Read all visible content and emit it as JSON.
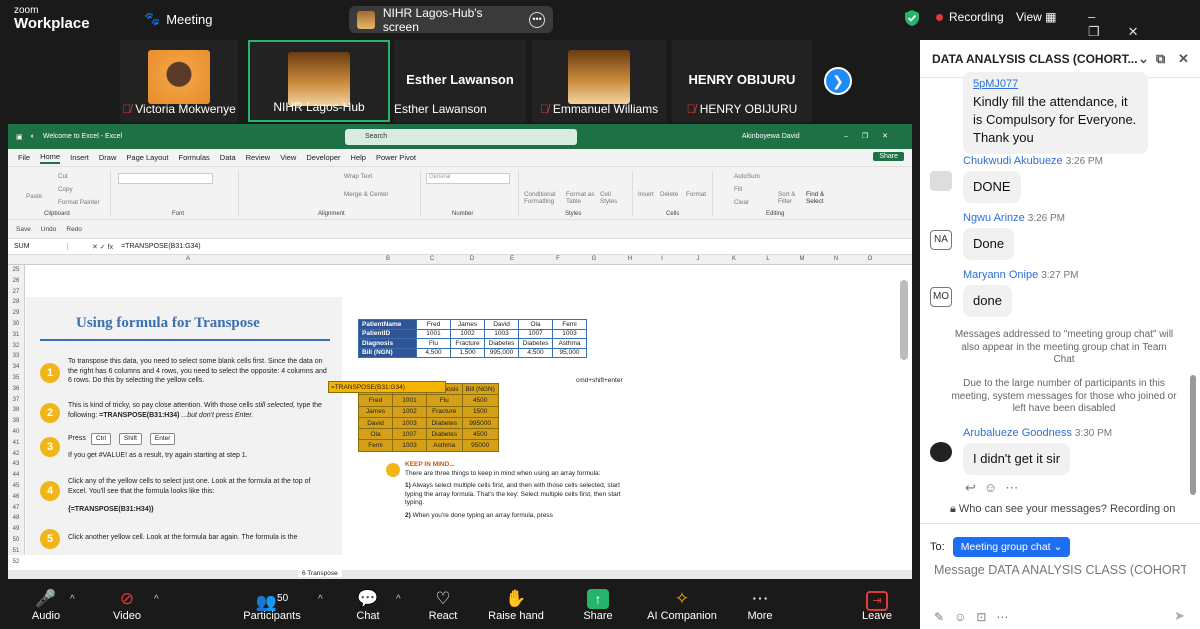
{
  "zoom": {
    "logo_line1": "zoom",
    "logo_line2": "Workplace",
    "meeting_label": "Meeting",
    "screen_share_title": "NIHR Lagos-Hub's screen",
    "recording_label": "Recording",
    "view_label": "View"
  },
  "participants": [
    {
      "name": "Victoria Mokwenye",
      "muted": true
    },
    {
      "name": "NIHR Lagos-Hub",
      "muted": false
    },
    {
      "name": "Esther  Lawanson",
      "big_name": "Esther  Lawanson",
      "muted": false
    },
    {
      "name": "Emmanuel Williams",
      "muted": true
    },
    {
      "name": "HENRY OBIJURU",
      "big_name": "HENRY OBIJURU",
      "muted": true
    }
  ],
  "excel": {
    "window_title": "Welcome to Excel  -  Excel",
    "search_placeholder": "Search",
    "user_name": "Akinboyewa David",
    "menu": [
      "File",
      "Home",
      "Insert",
      "Draw",
      "Page Layout",
      "Formulas",
      "Data",
      "Review",
      "View",
      "Developer",
      "Help",
      "Power Pivot"
    ],
    "active_menu": "Home",
    "share_label": "Share",
    "ribbon": {
      "cut": "Cut",
      "copy": "Copy",
      "paste": "Paste",
      "format_painter": "Format Painter",
      "clipboard": "Clipboard",
      "font": "Font",
      "alignment": "Alignment",
      "number": "Number",
      "styles": "Styles",
      "cells": "Cells",
      "editing": "Editing",
      "wrap_text": "Wrap Text",
      "merge_center": "Merge & Center",
      "general": "General",
      "conditional_formatting": "Conditional Formatting",
      "format_as_table": "Format as Table",
      "cell_styles": "Cell Styles",
      "insert": "Insert",
      "delete": "Delete",
      "format": "Format",
      "autosum": "AutoSum",
      "fill": "Fill",
      "clear": "Clear",
      "sort_filter": "Sort & Filter",
      "find_select": "Find & Select"
    },
    "quick_access": {
      "save": "Save",
      "undo": "Undo",
      "redo": "Redo"
    },
    "name_box": "SUM",
    "formula_bar": "=TRANSPOSE(B31:G34)",
    "columns": [
      "A",
      "B",
      "C",
      "D",
      "E",
      "F",
      "G",
      "H",
      "I",
      "J",
      "K",
      "L",
      "M",
      "N",
      "O"
    ],
    "rows": [
      "25",
      "26",
      "27",
      "28",
      "29",
      "30",
      "31",
      "32",
      "33",
      "34",
      "35",
      "36",
      "37",
      "38",
      "39",
      "40",
      "41",
      "42",
      "43",
      "44",
      "45",
      "46",
      "47",
      "48",
      "49",
      "50",
      "51",
      "52"
    ],
    "instructions": {
      "title": "Using formula for Transpose",
      "step1": "To transpose this data, you need to select some blank cells first. Since the data on the right has 6 columns and 4 rows, you need to select the opposite: 4 columns and 6 rows. Do this by selecting the yellow cells.",
      "step2_a": "This is kind of tricky, so pay close attention. With those cells ",
      "step2_b": "still selected,",
      "step2_c": " type the following: ",
      "step2_d": "=TRANSPOSE(B31:H34)",
      "step2_e": "  ...but don't press Enter.",
      "step3_press": "Press",
      "key_ctrl": "Ctrl",
      "key_shift": "Shift",
      "key_enter": "Enter",
      "step3_b": "If you get #VALUE! as a result, try again starting at step 1.",
      "step4": "Click any of the yellow cells to select just one. Look at the formula at the top of Excel. You'll see that the formula looks like this:",
      "step4_formula": "{=TRANSPOSE(B31:H34)}",
      "step5": "Click another yellow cell. Look at the formula bar again. The formula is the"
    },
    "patient_table": [
      [
        "PatientName",
        "Fred",
        "James",
        "David",
        "Ola",
        "Femi"
      ],
      [
        "PatientID",
        "1001",
        "1002",
        "1003",
        "1007",
        "1003"
      ],
      [
        "Diagnosis",
        "Flu",
        "Fracture",
        "Diabetes",
        "Diabetes",
        "Asthma"
      ],
      [
        "Bill (NGN)",
        "4,500",
        "1,500",
        "995,000",
        "4,500",
        "95,000"
      ]
    ],
    "transpose_formula_cell": "=TRANSPOSE(B31:G34)",
    "transposed_header": [
      "",
      "",
      "Diagnosis",
      "Bill (NGN)"
    ],
    "transposed_table": [
      [
        "Fred",
        "1001",
        "Flu",
        "4500"
      ],
      [
        "James",
        "1002",
        "Fracture",
        "1500"
      ],
      [
        "David",
        "1003",
        "Diabetes",
        "995000"
      ],
      [
        "Ola",
        "1007",
        "Diabetes",
        "4500"
      ],
      [
        "Femi",
        "1003",
        "Asthma",
        "95000"
      ]
    ],
    "cmd_note": "cmd+shift+enter",
    "keep": {
      "title": "KEEP IN MIND...",
      "intro": "There are three things to keep in mind when using an array formula:",
      "p1_num": "1)",
      "p1": " Always select multiple cells first, and then with those cells selected, start typing the array formula. That's the key: Select multiple cells first, then start typing.",
      "p2_num": "2)",
      "p2": " When you're done typing an array formula, press"
    },
    "sheet_tab": "6 Transpose"
  },
  "toolbar": {
    "audio": "Audio",
    "video": "Video",
    "participants": "Participants",
    "participants_count": "50",
    "chat": "Chat",
    "react": "React",
    "raise_hand": "Raise hand",
    "share": "Share",
    "ai_companion": "AI Companion",
    "more": "More",
    "leave": "Leave"
  },
  "chat": {
    "title": "DATA ANALYSIS CLASS (COHORT...",
    "first_msg": "Kindly fill the attendance, it is Compulsory for Everyone. Thank you",
    "first_msg_link_fragment": "5pMJ077",
    "messages": [
      {
        "sender": "Chukwudi Akubueze",
        "time": "3:26 PM",
        "text": "DONE",
        "avatar": ""
      },
      {
        "sender": "Ngwu Arinze",
        "time": "3:26 PM",
        "text": "Done",
        "avatar": "NA"
      },
      {
        "sender": "Maryann Onipe",
        "time": "3:27 PM",
        "text": "done",
        "avatar": "MO"
      },
      {
        "sender": "Arubalueze Goodness",
        "time": "3:30 PM",
        "text": "I didn't get it sir",
        "avatar": ""
      }
    ],
    "system1": "Messages addressed to \"meeting group chat\" will also appear in the meeting group chat in Team Chat",
    "system2": "Due to the large number of participants in this meeting, system messages for those who joined or left have been disabled",
    "who_can_see": "Who can see your messages? Recording on",
    "to_label": "To:",
    "recipient": "Meeting group chat",
    "compose_placeholder": "Message DATA ANALYSIS CLASS (COHORT..."
  },
  "colors": {
    "zoom_bg": "#1a1a1a",
    "excel_green": "#1e7145",
    "active_tile_border": "#26b36a",
    "recording_red": "#e03a3a",
    "chat_blue": "#2d6fd6",
    "yellow_cells": "#d4a017",
    "table_header_blue": "#2f5597"
  }
}
